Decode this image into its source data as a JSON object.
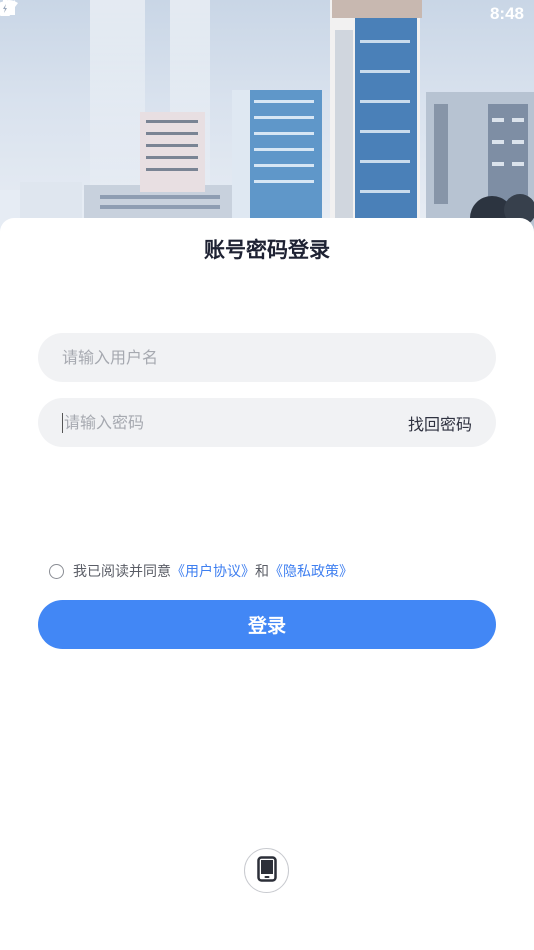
{
  "status_bar": {
    "time": "8:48",
    "icons": [
      "wifi-icon",
      "cellular-signal-icon",
      "battery-icon"
    ]
  },
  "header": {
    "illustration": "city-skyline-illustration"
  },
  "login": {
    "title": "账号密码登录",
    "username_placeholder": "请输入用户名",
    "password_placeholder": "请输入密码",
    "forgot_password_label": "找回密码",
    "agreement": {
      "prefix": "我已阅读并同意",
      "user_agreement_link": "《用户协议》",
      "conjunction": "和",
      "privacy_policy_link": "《隐私政策》",
      "checked": false
    },
    "submit_label": "登录",
    "alt_login_icon": "mobile-phone-icon"
  },
  "colors": {
    "primary": "#4287f5",
    "link": "#3f7ff0",
    "input_bg": "#f1f2f4",
    "title": "#1e2233"
  }
}
